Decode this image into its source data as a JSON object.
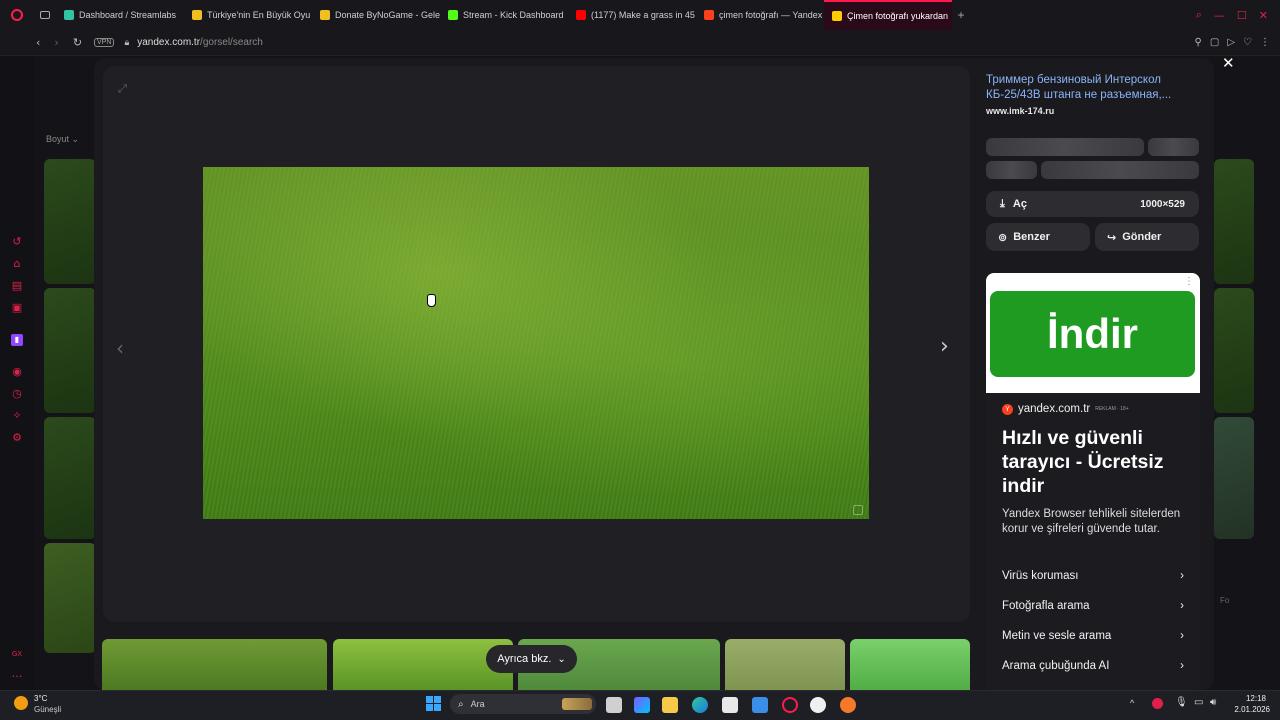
{
  "browser": {
    "tabs": [
      {
        "label": "Dashboard / Streamlabs",
        "fav_color": "#31c3a2"
      },
      {
        "label": "Türkiye'nin En Büyük Oyu",
        "fav_color": "#f0c020"
      },
      {
        "label": "Donate ByNoGame - Gele",
        "fav_color": "#f0c020"
      },
      {
        "label": "Stream - Kick Dashboard",
        "fav_color": "#53fc18"
      },
      {
        "label": "(1177) Make a grass in 45",
        "fav_color": "#ff0000"
      },
      {
        "label": "çimen fotoğrafı — Yandex",
        "fav_color": "#fc3f1d"
      },
      {
        "label": "Çimen fotoğrafı yukardan",
        "fav_color": "#ffcc00"
      }
    ],
    "new_tab": "+",
    "url_domain": "yandex.com.tr",
    "url_path": "/gorsel/search",
    "vpn_label": "VPN"
  },
  "background": {
    "filter_label": "Boyut",
    "right_text": "Fo"
  },
  "viewer": {
    "source_title": "Триммер бензиновый Интерскол КБ-25/43В штанга не разъемная,...",
    "source_site": "www.imk-174.ru",
    "open_label": "Aç",
    "dimensions": "1000×529",
    "similar_label": "Benzer",
    "share_label": "Gönder",
    "see_also_label": "Ayrıca bkz."
  },
  "ad": {
    "banner_text": "İndir",
    "banner_color": "#1f9b22",
    "domain": "yandex.com.tr",
    "ad_tag": "REKLAM · 18+",
    "headline": "Hızlı ve güvenli tarayıcı - Ücretsiz indir",
    "body": "Yandex Browser tehlikeli sitelerden korur ve şifreleri güvende tutar.",
    "menu": [
      "Virüs koruması",
      "Fotoğrafla arama",
      "Metin ve sesle arama",
      "Arama çubuğunda AI"
    ]
  },
  "taskbar": {
    "weather_temp": "3°C",
    "weather_desc": "Güneşli",
    "search_placeholder": "Ara",
    "time": "12:18",
    "date": "2.01.2026"
  },
  "colors": {
    "accent": "#ff1b4d",
    "link": "#8ab4f8"
  }
}
